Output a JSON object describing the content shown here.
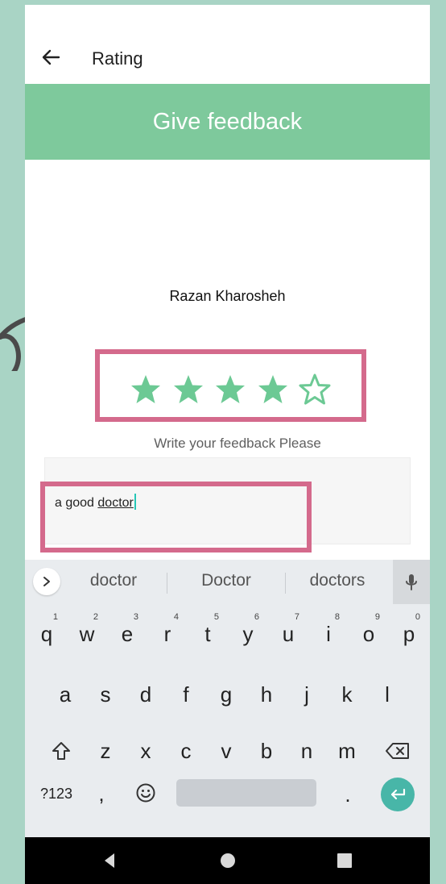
{
  "appbar": {
    "title": "Rating"
  },
  "banner": {
    "title": "Give feedback"
  },
  "doctor": {
    "name": "Razan Kharosheh"
  },
  "rating": {
    "value": 4,
    "max": 5
  },
  "feedback": {
    "prompt": "Write your feedback Please",
    "text_prefix": "a good ",
    "text_composing": "doctor"
  },
  "colors": {
    "accent": "#7ec99c",
    "star": "#6cc994",
    "highlight": "#d46a8c",
    "enter": "#48b6a8"
  },
  "keyboard": {
    "suggestions": [
      "doctor",
      "Doctor",
      "doctors"
    ],
    "row1": [
      "q",
      "w",
      "e",
      "r",
      "t",
      "y",
      "u",
      "i",
      "o",
      "p"
    ],
    "row1_hints": [
      "1",
      "2",
      "3",
      "4",
      "5",
      "6",
      "7",
      "8",
      "9",
      "0"
    ],
    "row2": [
      "a",
      "s",
      "d",
      "f",
      "g",
      "h",
      "j",
      "k",
      "l"
    ],
    "row3": [
      "z",
      "x",
      "c",
      "v",
      "b",
      "n",
      "m"
    ],
    "symbols_label": "?123",
    "comma": ",",
    "period": "."
  },
  "icons": [
    "arrow-left-icon",
    "star-icon",
    "chevron-right-icon",
    "mic-icon",
    "shift-icon",
    "backspace-icon",
    "emoji-icon",
    "enter-icon",
    "nav-back-icon",
    "nav-home-icon",
    "nav-recents-icon"
  ]
}
